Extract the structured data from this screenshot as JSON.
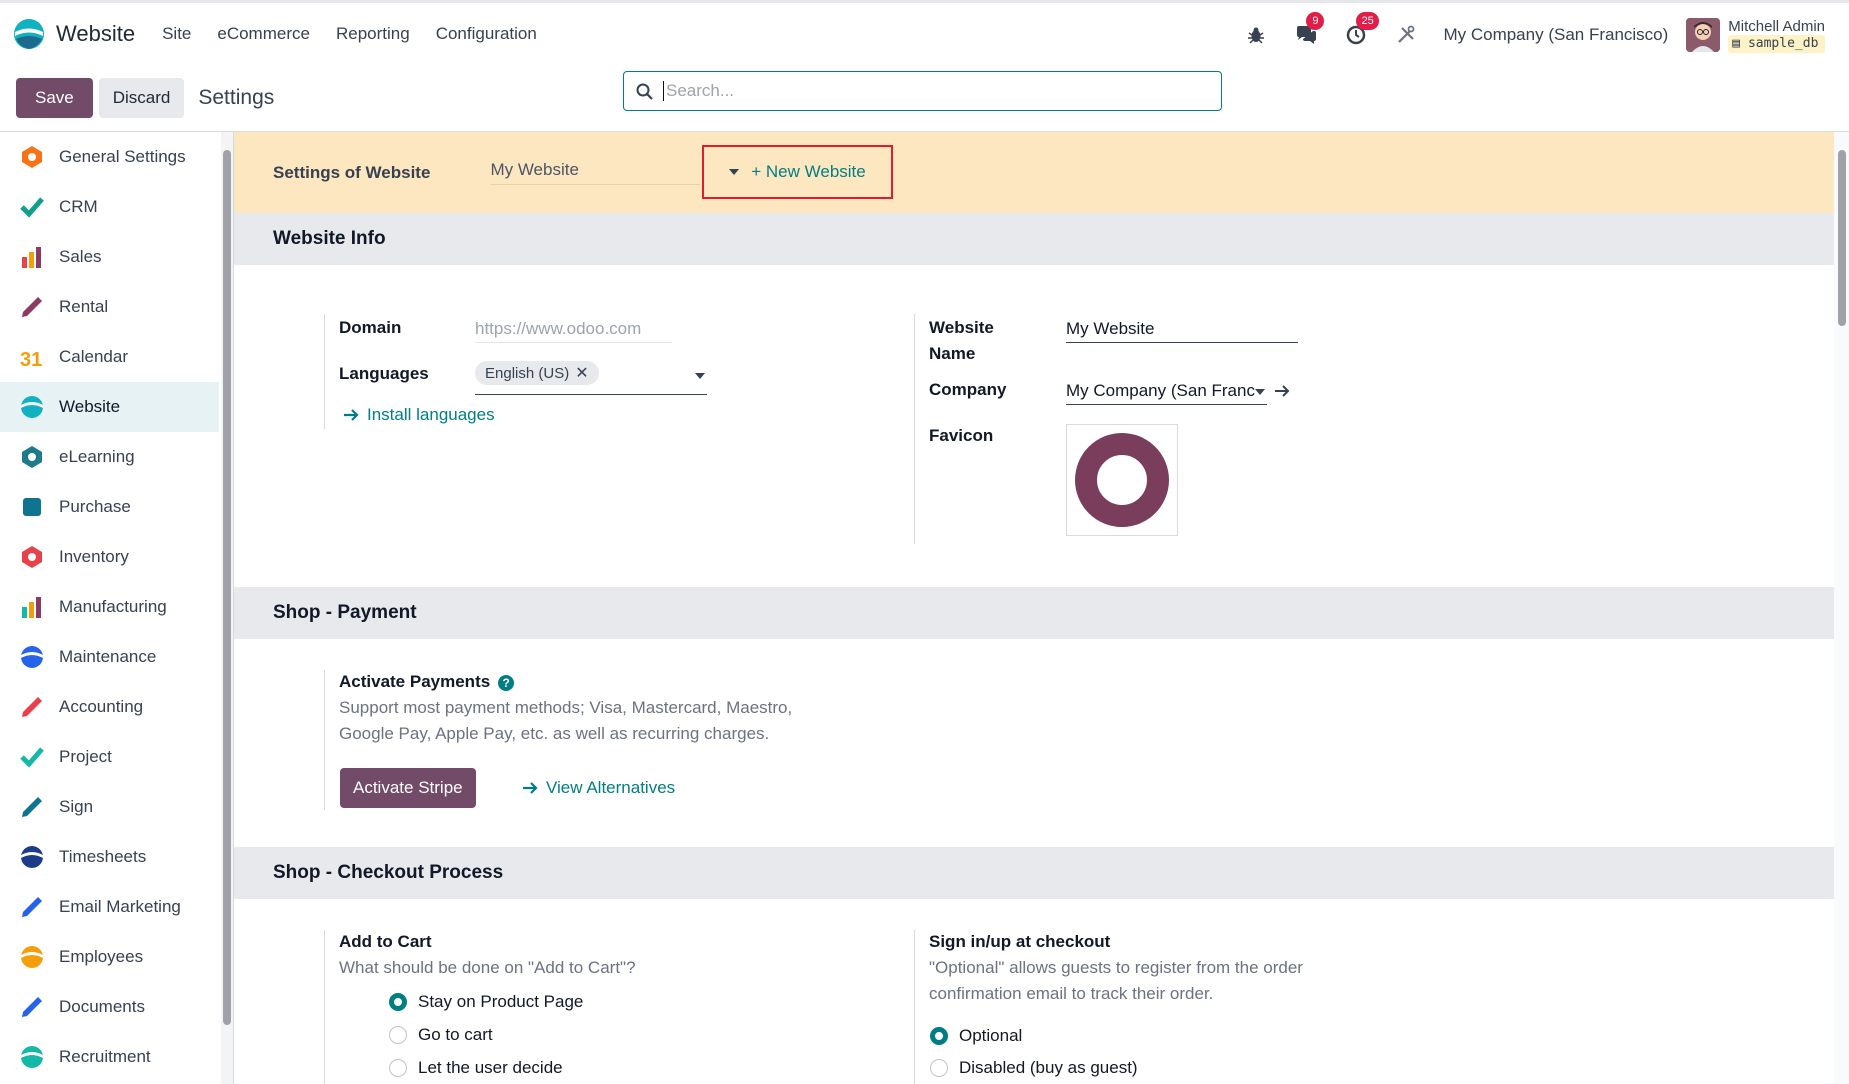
{
  "navbar": {
    "app_title": "Website",
    "menus": [
      "Site",
      "eCommerce",
      "Reporting",
      "Configuration"
    ],
    "messages_count": "9",
    "activities_count": "25",
    "company": "My Company (San Francisco)",
    "user_name": "Mitchell Admin",
    "db_name": "sample_db"
  },
  "control": {
    "save_label": "Save",
    "discard_label": "Discard",
    "title": "Settings",
    "search_placeholder": "Search..."
  },
  "sidebar": {
    "items": [
      {
        "label": "General Settings",
        "icon": "general-settings-icon",
        "color": "#f97316"
      },
      {
        "label": "CRM",
        "icon": "crm-icon",
        "color": "#0e9f8e"
      },
      {
        "label": "Sales",
        "icon": "sales-icon",
        "color": "#e8414b"
      },
      {
        "label": "Rental",
        "icon": "rental-icon",
        "color": "#8b3a62"
      },
      {
        "label": "Calendar",
        "icon": "calendar-icon",
        "color": "#f59e0b"
      },
      {
        "label": "Website",
        "icon": "website-icon",
        "color": "#10b2c1"
      },
      {
        "label": "eLearning",
        "icon": "elearning-icon",
        "color": "#1f7a8c"
      },
      {
        "label": "Purchase",
        "icon": "purchase-icon",
        "color": "#0e7490"
      },
      {
        "label": "Inventory",
        "icon": "inventory-icon",
        "color": "#e8414b"
      },
      {
        "label": "Manufacturing",
        "icon": "manufacturing-icon",
        "color": "#14b8a6"
      },
      {
        "label": "Maintenance",
        "icon": "maintenance-icon",
        "color": "#2563eb"
      },
      {
        "label": "Accounting",
        "icon": "accounting-icon",
        "color": "#e8414b"
      },
      {
        "label": "Project",
        "icon": "project-icon",
        "color": "#14b8a6"
      },
      {
        "label": "Sign",
        "icon": "sign-icon",
        "color": "#0e7490"
      },
      {
        "label": "Timesheets",
        "icon": "timesheets-icon",
        "color": "#1e3a8a"
      },
      {
        "label": "Email Marketing",
        "icon": "email-marketing-icon",
        "color": "#2563eb"
      },
      {
        "label": "Employees",
        "icon": "employees-icon",
        "color": "#f59e0b"
      },
      {
        "label": "Documents",
        "icon": "documents-icon",
        "color": "#2563eb"
      },
      {
        "label": "Recruitment",
        "icon": "recruitment-icon",
        "color": "#14b8a6"
      }
    ],
    "active_index": 5
  },
  "website_bar": {
    "label": "Settings of Website",
    "selected_website": "My Website",
    "new_website": "+ New Website"
  },
  "website_info": {
    "title": "Website Info",
    "domain_label": "Domain",
    "domain_placeholder": "https://www.odoo.com",
    "languages_label": "Languages",
    "language_tag": "English (US)",
    "install_languages": "Install languages",
    "website_name_label_1": "Website",
    "website_name_label_2": "Name",
    "website_name_value": "My Website",
    "company_label": "Company",
    "company_value": "My Company (San Franc",
    "favicon_label": "Favicon"
  },
  "shop_payment": {
    "title": "Shop - Payment",
    "activate_label": "Activate Payments",
    "desc_1": "Support most payment methods; Visa, Mastercard, Maestro,",
    "desc_2": "Google Pay, Apple Pay, etc. as well as recurring charges.",
    "activate_button": "Activate Stripe",
    "view_alternatives": "View Alternatives"
  },
  "shop_checkout": {
    "title": "Shop - Checkout Process",
    "add_to_cart_label": "Add to Cart",
    "add_to_cart_desc": "What should be done on \"Add to Cart\"?",
    "cart_options": [
      "Stay on Product Page",
      "Go to cart",
      "Let the user decide"
    ],
    "cart_selected": 0,
    "signin_label": "Sign in/up at checkout",
    "signin_desc_1": "\"Optional\" allows guests to register from the order",
    "signin_desc_2": "confirmation email to track their order.",
    "signin_options": [
      "Optional",
      "Disabled (buy as guest)"
    ],
    "signin_selected": 0
  },
  "colors": {
    "primary": "#714b67",
    "link": "#017e84",
    "website_bar_bg": "#fde7c1",
    "highlight_border": "#e11d2b",
    "badge": "#e11d48"
  }
}
